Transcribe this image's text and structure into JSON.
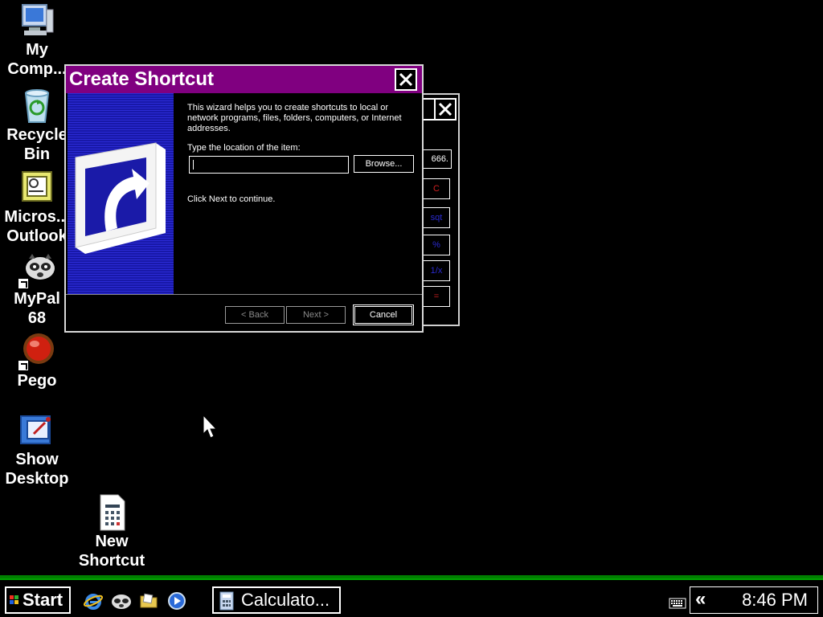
{
  "desktop": {
    "icons": [
      {
        "label": "My\nComp..."
      },
      {
        "label": "Recycle\nBin"
      },
      {
        "label": "Micros...\nOutlook"
      },
      {
        "label": "MyPal\n68"
      },
      {
        "label": "Pego"
      },
      {
        "label": "Show\nDesktop"
      },
      {
        "label": "New\nShortcut"
      }
    ]
  },
  "calculator_window": {
    "display_value": "666.",
    "keys": [
      "C",
      "sqt",
      "%",
      "1/x",
      "="
    ]
  },
  "dialog": {
    "title": "Create Shortcut",
    "intro_text": "This wizard helps you to create shortcuts to local or network programs, files, folders, computers, or Internet addresses.",
    "location_label": "Type the location of the item:",
    "location_value": "",
    "browse_label": "Browse...",
    "continue_text": "Click Next to continue.",
    "back_label": "< Back",
    "next_label": "Next >",
    "cancel_label": "Cancel"
  },
  "taskbar": {
    "start_label": "Start",
    "task_button_label": "Calculato...",
    "tray_chevron": "«",
    "clock": "8:46 PM"
  },
  "colors": {
    "titlebar": "#800080",
    "taskbar": "#008000",
    "desktop": "#000000"
  }
}
